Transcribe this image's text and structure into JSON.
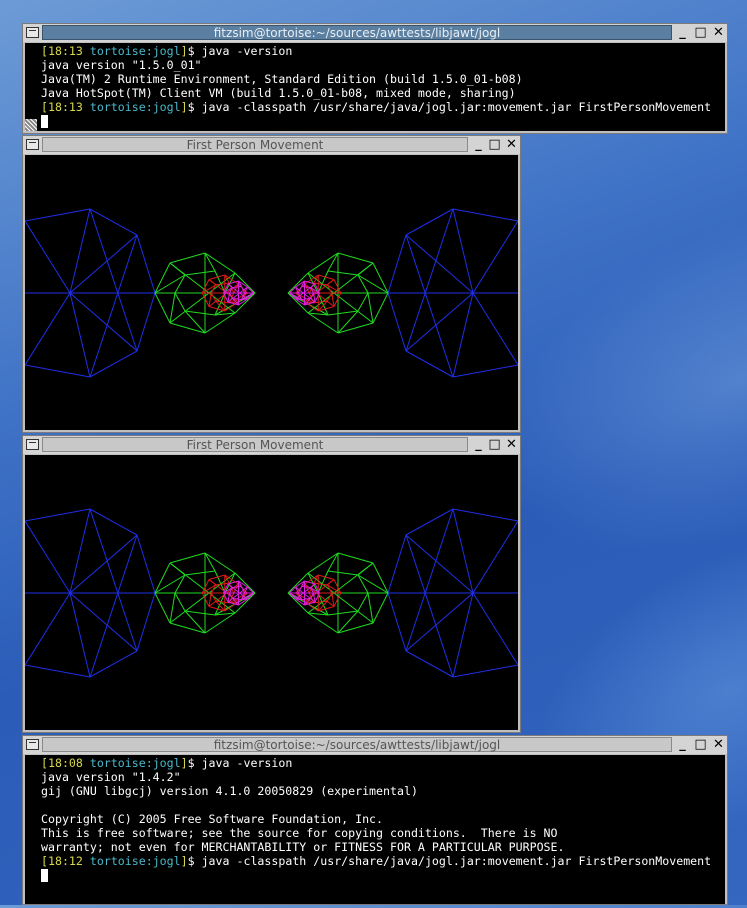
{
  "top_terminal": {
    "title": "fitzsim@tortoise:~/sources/awttests/libjawt/jogl",
    "lines": [
      {
        "time": "18:13",
        "host": "tortoise:jogl",
        "cmd": "java -version"
      },
      {
        "text": "java version \"1.5.0_01\""
      },
      {
        "text": "Java(TM) 2 Runtime Environment, Standard Edition (build 1.5.0_01-b08)"
      },
      {
        "text": "Java HotSpot(TM) Client VM (build 1.5.0_01-b08, mixed mode, sharing)"
      },
      {
        "time": "18:13",
        "host": "tortoise:jogl",
        "cmd": "java -classpath /usr/share/java/jogl.jar:movement.jar FirstPersonMovement"
      }
    ]
  },
  "gl_window_1": {
    "title": "First Person Movement"
  },
  "gl_window_2": {
    "title": "First Person Movement"
  },
  "bottom_terminal": {
    "title": "fitzsim@tortoise:~/sources/awttests/libjawt/jogl",
    "lines": [
      {
        "time": "18:08",
        "host": "tortoise:jogl",
        "cmd": "java -version"
      },
      {
        "text": "java version \"1.4.2\""
      },
      {
        "text": "gij (GNU libgcj) version 4.1.0 20050829 (experimental)"
      },
      {
        "text": ""
      },
      {
        "text": "Copyright (C) 2005 Free Software Foundation, Inc."
      },
      {
        "text": "This is free software; see the source for copying conditions.  There is NO"
      },
      {
        "text": "warranty; not even for MERCHANTABILITY or FITNESS FOR A PARTICULAR PURPOSE."
      },
      {
        "time": "18:12",
        "host": "tortoise:jogl",
        "cmd": "java -classpath /usr/share/java/jogl.jar:movement.jar FirstPersonMovement"
      }
    ]
  },
  "window_buttons": {
    "minimize": "_",
    "maximize": "□",
    "close": "✕"
  },
  "colors": {
    "wire_blue": "#1f2fe8",
    "wire_green": "#1fdc1f",
    "wire_red": "#e01818",
    "wire_magenta": "#e020e0",
    "desktop": "#3f73c6"
  }
}
